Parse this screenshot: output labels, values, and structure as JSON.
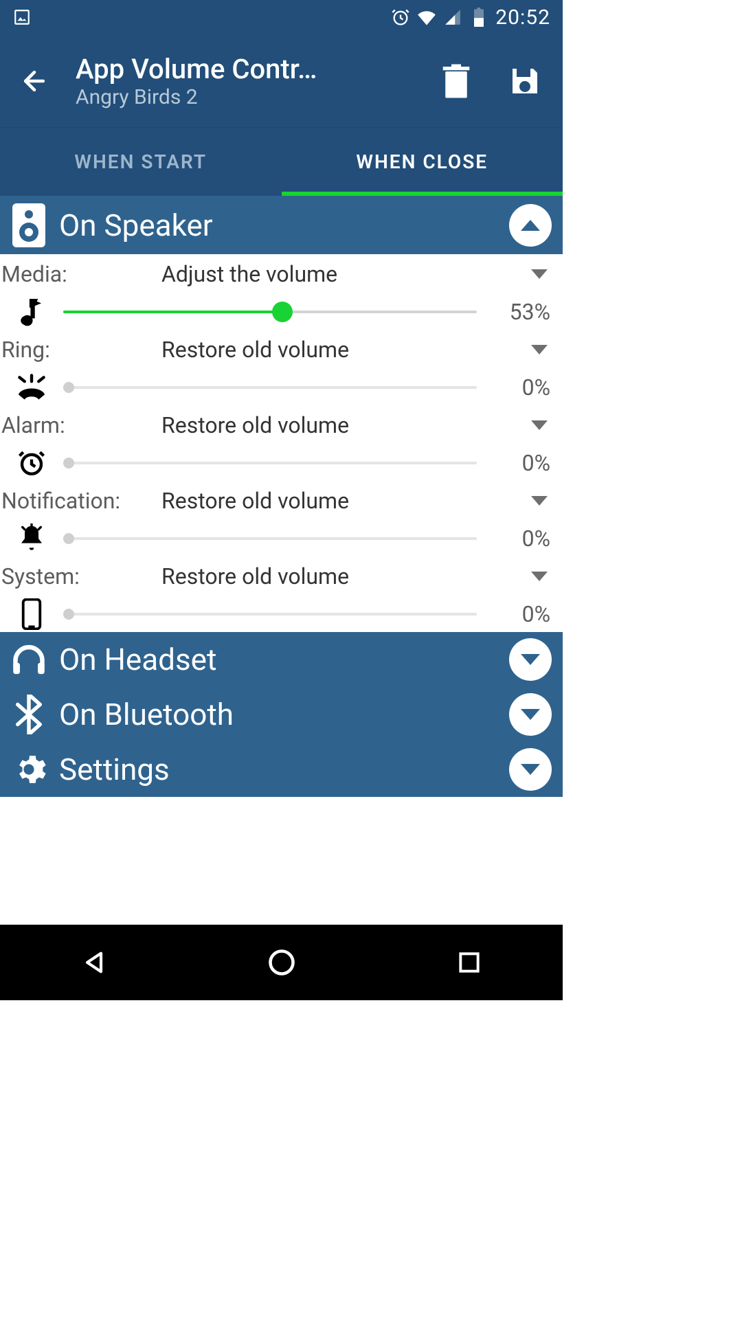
{
  "status": {
    "time": "20:52"
  },
  "header": {
    "title": "App Volume Contr…",
    "subtitle": "Angry Birds 2"
  },
  "tabs": {
    "start": "WHEN START",
    "close": "WHEN CLOSE"
  },
  "sections": {
    "speaker": "On Speaker",
    "headset": "On Headset",
    "bluetooth": "On Bluetooth",
    "settings": "Settings"
  },
  "rows": {
    "media": {
      "label": "Media:",
      "action": "Adjust the volume",
      "pct": "53%",
      "value": 53,
      "enabled": true
    },
    "ring": {
      "label": "Ring:",
      "action": "Restore old volume",
      "pct": "0%",
      "value": 0,
      "enabled": false
    },
    "alarm": {
      "label": "Alarm:",
      "action": "Restore old volume",
      "pct": "0%",
      "value": 0,
      "enabled": false
    },
    "notification": {
      "label": "Notification:",
      "action": "Restore old volume",
      "pct": "0%",
      "value": 0,
      "enabled": false
    },
    "system": {
      "label": "System:",
      "action": "Restore old volume",
      "pct": "0%",
      "value": 0,
      "enabled": false
    }
  },
  "colors": {
    "brand": "#224e79",
    "brandLight": "#2f638e",
    "accent": "#18d333"
  }
}
